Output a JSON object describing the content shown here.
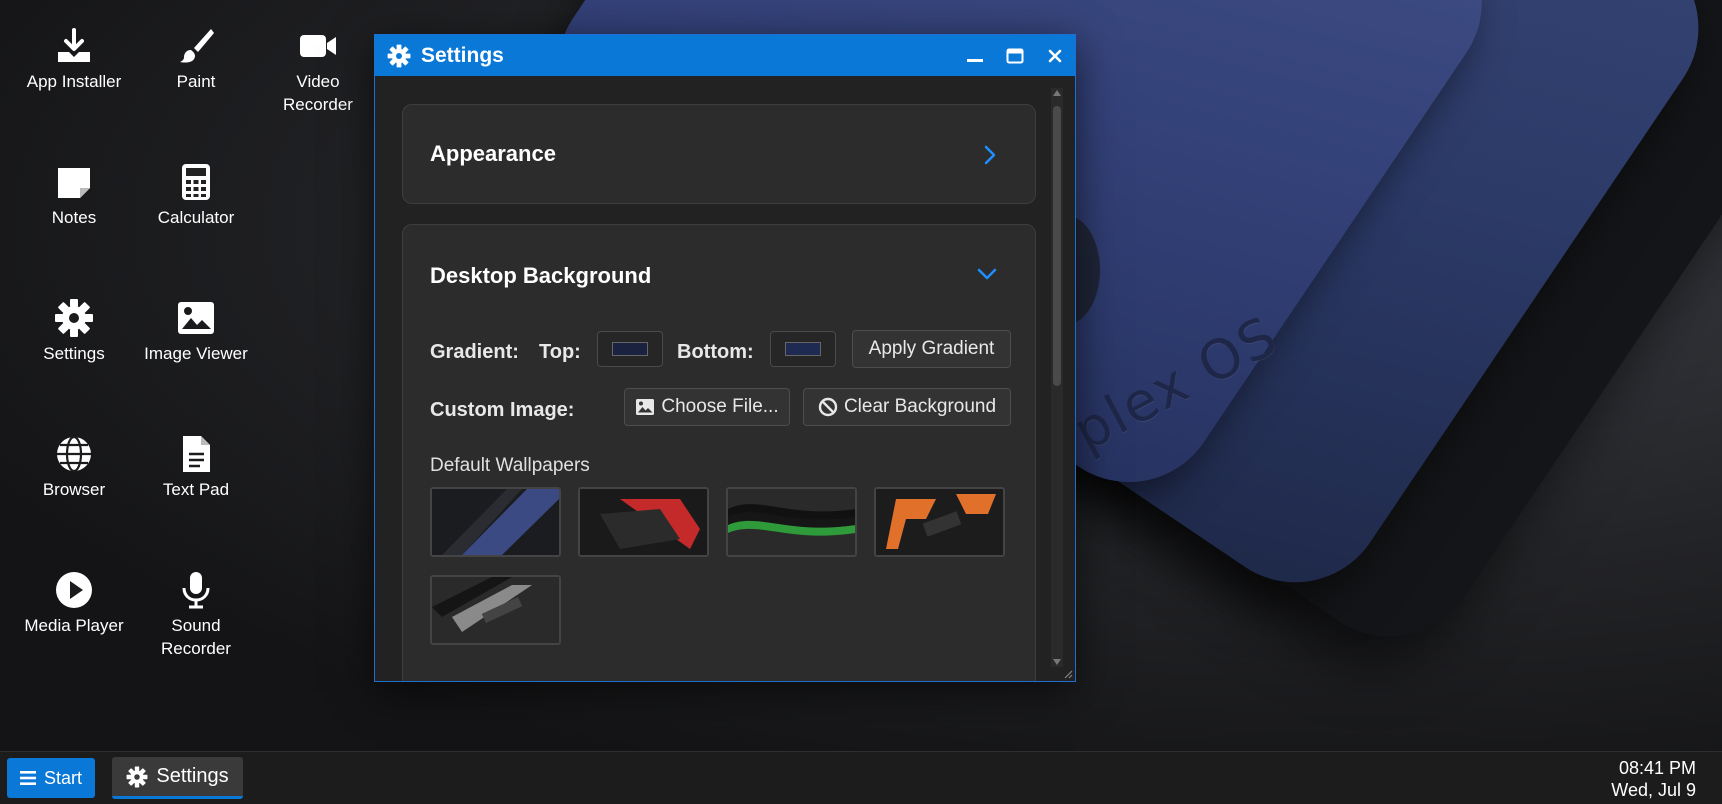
{
  "desktop": {
    "wallpaper_text": "plex OS",
    "icons": [
      {
        "label": "App Installer",
        "icon": "download-icon"
      },
      {
        "label": "Paint",
        "icon": "brush-icon"
      },
      {
        "label": "Video Recorder",
        "icon": "video-camera-icon"
      },
      {
        "label": "Notes",
        "icon": "sticky-note-icon"
      },
      {
        "label": "Calculator",
        "icon": "calculator-icon"
      },
      {
        "label": "Settings",
        "icon": "gear-icon"
      },
      {
        "label": "Image Viewer",
        "icon": "image-icon"
      },
      {
        "label": "Browser",
        "icon": "globe-icon"
      },
      {
        "label": "Text Pad",
        "icon": "document-icon"
      },
      {
        "label": "Media Player",
        "icon": "play-icon"
      },
      {
        "label": "Sound Recorder",
        "icon": "microphone-icon"
      }
    ]
  },
  "window": {
    "title": "Settings",
    "accent": "#0a78d7",
    "appearance": {
      "title": "Appearance"
    },
    "background": {
      "title": "Desktop Background",
      "gradient_label": "Gradient:",
      "top_label": "Top:",
      "bottom_label": "Bottom:",
      "top_color": "#1a2240",
      "bottom_color": "#1f2a52",
      "apply_label": "Apply Gradient",
      "custom_label": "Custom Image:",
      "choose_label": "Choose File...",
      "clear_label": "Clear Background",
      "defaults_label": "Default Wallpapers",
      "wallpapers": [
        {
          "name": "blue",
          "color": "#3b4a82"
        },
        {
          "name": "red",
          "color": "#c42a2a"
        },
        {
          "name": "green",
          "color": "#2f9a3a"
        },
        {
          "name": "orange",
          "color": "#e0702a"
        },
        {
          "name": "gray",
          "color": "#8a8a8a"
        }
      ]
    }
  },
  "taskbar": {
    "start_label": "Start",
    "task_label": "Settings",
    "time": "08:41 PM",
    "date": "Wed, Jul 9"
  }
}
